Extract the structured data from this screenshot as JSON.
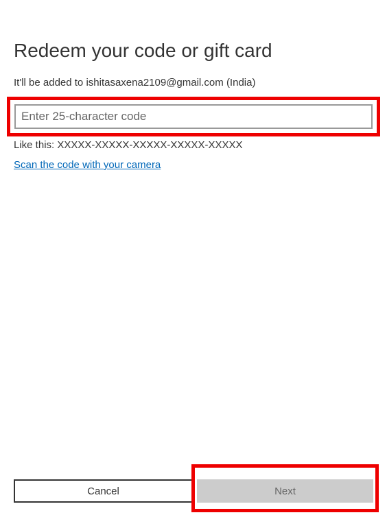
{
  "heading": "Redeem your code or gift card",
  "added_to_text": "It'll be added to ishitasaxena2109@gmail.com (India)",
  "input": {
    "placeholder": "Enter 25-character code",
    "value": ""
  },
  "hint_text": "Like this: XXXXX-XXXXX-XXXXX-XXXXX-XXXXX",
  "scan_link_text": "Scan the code with your camera",
  "buttons": {
    "cancel": "Cancel",
    "next": "Next"
  }
}
